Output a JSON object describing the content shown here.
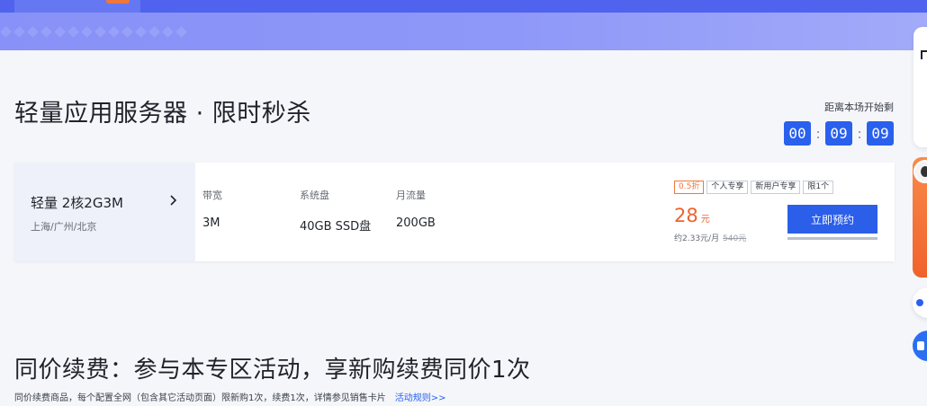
{
  "section1": {
    "title": "轻量应用服务器 · 限时秒杀",
    "countdown": {
      "label": "距离本场开始剩",
      "hours": "00",
      "minutes": "09",
      "seconds": "09",
      "separator": ":"
    }
  },
  "product": {
    "name": "轻量 2核2G3M",
    "regions": "上海/广州/北京",
    "specs": [
      {
        "label": "带宽",
        "value": "3M"
      },
      {
        "label": "系统盘",
        "value": "40GB SSD盘"
      },
      {
        "label": "月流量",
        "value": "200GB"
      }
    ],
    "tags": [
      "0.5折",
      "个人专享",
      "新用户专享",
      "限1个"
    ],
    "price": "28",
    "price_unit": "元",
    "monthly": "约2.33元/月",
    "original_price": "540元",
    "reserve_label": "立即预约",
    "stock_progress": 1.0
  },
  "section2": {
    "title": "同价续费：参与本专区活动，享新购续费同价1次",
    "note": "同价续费商品，每个配置全网（包含其它活动页面）限新购1次，续费1次，详情参见销售卡片",
    "rules_link": "活动规则>>"
  },
  "colors": {
    "accent": "#2960ee",
    "price": "#f0622b",
    "banner": "#8791f7"
  }
}
